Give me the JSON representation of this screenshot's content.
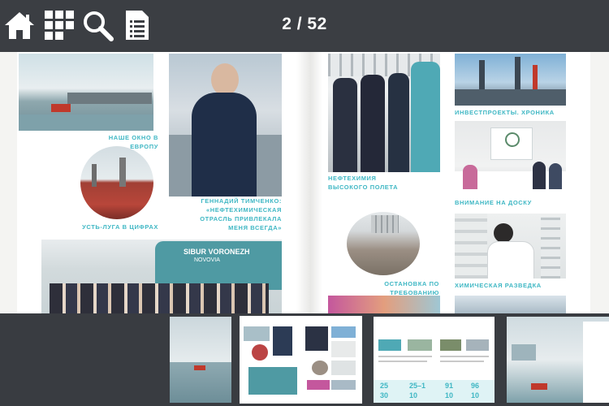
{
  "toolbar": {
    "icons": [
      "home-icon",
      "grid-icon",
      "search-icon",
      "document-icon"
    ],
    "page_counter": "2 / 52"
  },
  "left_page": {
    "captions": {
      "window": "НАШЕ ОКНО В ЕВРОПУ",
      "ust_luga": "УСТЬ-ЛУГА В ЦИФРАХ",
      "timchenko": "ГЕННАДИЙ ТИМЧЕНКО: «НЕФТЕХИМИЧЕСКАЯ ОТРАСЛЬ ПРИВЛЕКАЛА МЕНЯ ВСЕГДА»"
    },
    "ship_name": "SIBUR VORONEZH",
    "ship_port": "NOVOVIA"
  },
  "right_page": {
    "captions": {
      "invest": "ИНВЕСТПРОЕКТЫ. ХРОНИКА",
      "neftechimia": "НЕФТЕХИМИЯ ВЫСОКОГО ПОЛЕТА",
      "board": "ВНИМАНИЕ НА ДОСКУ",
      "stop": "ОСТАНОВКА ПО ТРЕБОВАНИЮ",
      "chem": "ХИМИЧЕСКАЯ РАЗВЕДКА"
    }
  },
  "thumbnails": {
    "numbers": [
      "25",
      "30",
      "25–1",
      "10",
      "91",
      "10",
      "96",
      "10"
    ]
  },
  "colors": {
    "toolbar_bg": "#3b3e43",
    "accent": "#3fb7c4",
    "thumb_strip_bg": "#393c41"
  }
}
